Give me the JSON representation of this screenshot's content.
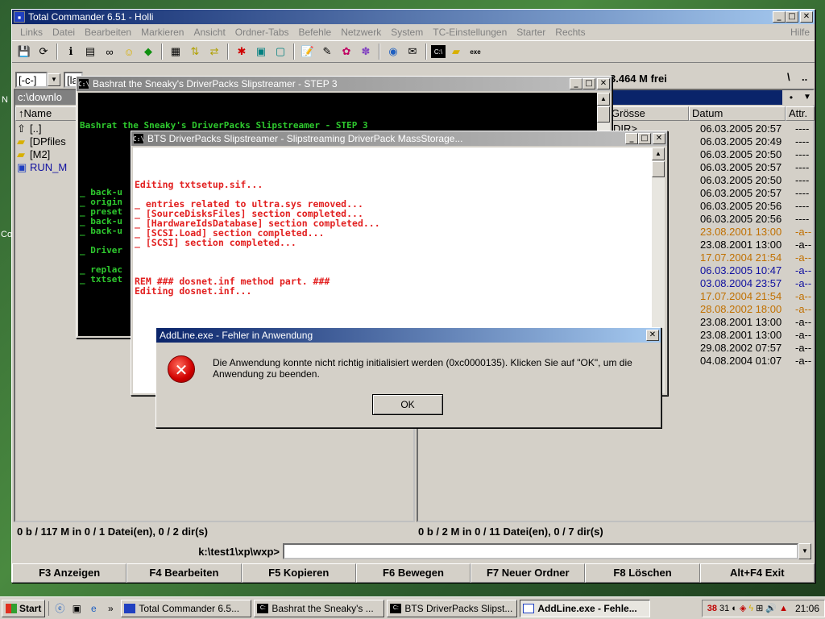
{
  "total_commander": {
    "title": "Total Commander 6.51 - Holli",
    "menu": [
      "Links",
      "Datei",
      "Bearbeiten",
      "Markieren",
      "Ansicht",
      "Ordner-Tabs",
      "Befehle",
      "Netzwerk",
      "System",
      "TC-Einstellungen",
      "Starter",
      "Rechts"
    ],
    "menu_right": "Hilfe",
    "left_drive": "[-c-]",
    "left_drive_label": "[la",
    "left_path": "c:\\downlo",
    "right_free": "3.464 M frei",
    "right_dirnav": "\\",
    "right_dirnav2": "..",
    "left_col_name": "↑Name",
    "left_files": [
      {
        "icon": "up-icon",
        "name": "[..]"
      },
      {
        "icon": "folder-icon",
        "name": "[DPfiles"
      },
      {
        "icon": "folder-icon",
        "name": "[M2]"
      },
      {
        "icon": "exe-icon",
        "name": "RUN_M"
      }
    ],
    "right_cols": {
      "size": "Grösse",
      "date": "Datum",
      "attr": "Attr."
    },
    "right_files": [
      {
        "size": "DIR>",
        "date": "06.03.2005 20:57",
        "attr": "----",
        "color": "#000000"
      },
      {
        "size": "",
        "date": "06.03.2005 20:49",
        "attr": "----",
        "color": "#000000"
      },
      {
        "size": "",
        "date": "06.03.2005 20:50",
        "attr": "----",
        "color": "#000000"
      },
      {
        "size": "",
        "date": "06.03.2005 20:57",
        "attr": "----",
        "color": "#000000"
      },
      {
        "size": "",
        "date": "06.03.2005 20:50",
        "attr": "----",
        "color": "#000000"
      },
      {
        "size": "",
        "date": "06.03.2005 20:57",
        "attr": "----",
        "color": "#000000"
      },
      {
        "size": "",
        "date": "06.03.2005 20:56",
        "attr": "----",
        "color": "#000000"
      },
      {
        "size": "",
        "date": "06.03.2005 20:56",
        "attr": "----",
        "color": "#000000"
      },
      {
        "size": "",
        "date": "23.08.2001 13:00",
        "attr": "-a--",
        "color": "#c07000"
      },
      {
        "size": "",
        "date": "23.08.2001 13:00",
        "attr": "-a--",
        "color": "#000000"
      },
      {
        "size": "",
        "date": "17.07.2004 21:54",
        "attr": "-a--",
        "color": "#c07000"
      },
      {
        "size": "",
        "date": "06.03.2005 10:47",
        "attr": "-a--",
        "color": "#1010a0"
      },
      {
        "size": "",
        "date": "03.08.2004 23:57",
        "attr": "-a--",
        "color": "#1010a0"
      },
      {
        "size": "",
        "date": "17.07.2004 21:54",
        "attr": "-a--",
        "color": "#c07000"
      },
      {
        "size": "",
        "date": "28.08.2002 18:00",
        "attr": "-a--",
        "color": "#c07000"
      },
      {
        "size": "",
        "date": "23.08.2001 13:00",
        "attr": "-a--",
        "color": "#000000"
      },
      {
        "size": "",
        "date": "23.08.2001 13:00",
        "attr": "-a--",
        "color": "#000000"
      },
      {
        "size": "",
        "date": "29.08.2002 07:57",
        "attr": "-a--",
        "color": "#000000"
      },
      {
        "size": "",
        "date": "04.08.2004 01:07",
        "attr": "-a--",
        "color": "#000000"
      }
    ],
    "status_left": "0 b / 117 M in 0 / 1 Datei(en), 0 / 2 dir(s)",
    "status_right": "0 b / 2 M in 0 / 11 Datei(en), 0 / 7 dir(s)",
    "cmd_path": "k:\\test1\\xp\\wxp>",
    "fkeys": [
      "F3 Anzeigen",
      "F4 Bearbeiten",
      "F5 Kopieren",
      "F6 Bewegen",
      "F7 Neuer Ordner",
      "F8 Löschen",
      "Alt+F4 Exit"
    ]
  },
  "step3_window": {
    "title": "Bashrat the Sneaky's DriverPacks Slipstreamer - STEP 3",
    "heading": "Bashrat the Sneaky's DriverPacks Slipstreamer - STEP 3",
    "lines": [
      "_ back-u",
      "_ origin",
      "_ preset",
      "_ back-u",
      "_ back-u",
      "",
      "_ Driver",
      "",
      "_ replac",
      "_ txtset"
    ]
  },
  "bts_window": {
    "title": "BTS DriverPacks Slipstreamer - Slipstreaming DriverPack MassStorage...",
    "log": "Editing txtsetup.sif...\n\n_ entries related to ultra.sys removed...\n_ [SourceDisksFiles] section completed...\n_ [HardwareIdsDatabase] section completed...\n_ [SCSI.Load] section completed...\n_ [SCSI] section completed...\n\n\n\nREM ### dosnet.inf method part. ###\nEditing dosnet.inf..."
  },
  "error_dialog": {
    "title": "AddLine.exe - Fehler in Anwendung",
    "message": "Die Anwendung konnte nicht richtig initialisiert werden (0xc0000135). Klicken Sie auf \"OK\", um die Anwendung zu beenden.",
    "ok_label": "OK"
  },
  "taskbar": {
    "start_label": "Start",
    "quick_more": "»",
    "tasks": [
      {
        "label": "Total Commander 6.5...",
        "active": false
      },
      {
        "label": "Bashrat the Sneaky's ...",
        "active": false
      },
      {
        "label": "BTS DriverPacks Slipst...",
        "active": false
      },
      {
        "label": "AddLine.exe - Fehle...",
        "active": true
      }
    ],
    "tray_nums": [
      "38",
      "31"
    ],
    "clock": "21:06"
  },
  "desktop": {
    "left_edge_labels": [
      "N",
      "Co"
    ]
  },
  "colors": {
    "title_active": "#0a246a",
    "console_green": "#2ec82e",
    "log_red": "#e22020",
    "selection_blue": "#0a246a"
  }
}
